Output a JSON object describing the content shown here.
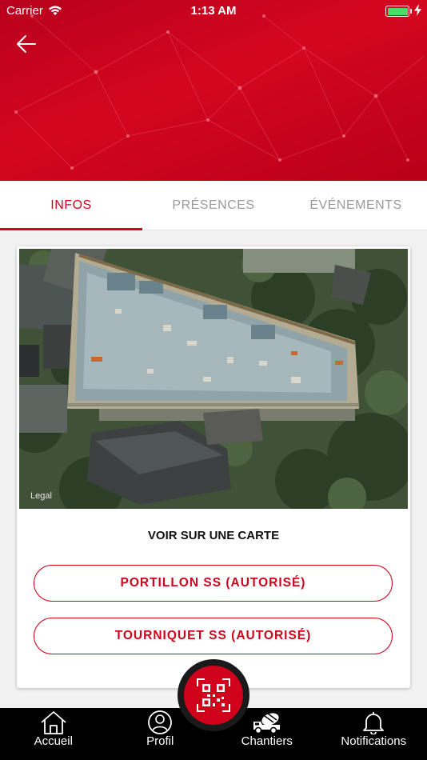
{
  "status_bar": {
    "carrier": "Carrier",
    "time": "1:13 AM"
  },
  "header": {
    "back_icon": "arrow-left-icon"
  },
  "tabs": [
    {
      "label": "INFOS",
      "active": true
    },
    {
      "label": "PRÉSENCES",
      "active": false
    },
    {
      "label": "ÉVÉNEMENTS",
      "active": false
    }
  ],
  "card": {
    "map_legal": "Legal",
    "map_link": "VOIR SUR UNE CARTE",
    "access_points": [
      {
        "label": "PORTILLON SS (AUTORISÉ)"
      },
      {
        "label": "TOURNIQUET SS (AUTORISÉ)"
      }
    ]
  },
  "qr_button": {
    "icon": "qr-code-scan-icon"
  },
  "bottom_nav": [
    {
      "label": "Accueil",
      "icon": "home-icon"
    },
    {
      "label": "Profil",
      "icon": "profile-icon"
    },
    {
      "label": "Chantiers",
      "icon": "concrete-mixer-truck-icon"
    },
    {
      "label": "Notifications",
      "icon": "bell-icon"
    }
  ],
  "colors": {
    "brand_red": "#d0021b",
    "tab_inactive": "#9a9a9a",
    "nav_bg": "#000000"
  }
}
